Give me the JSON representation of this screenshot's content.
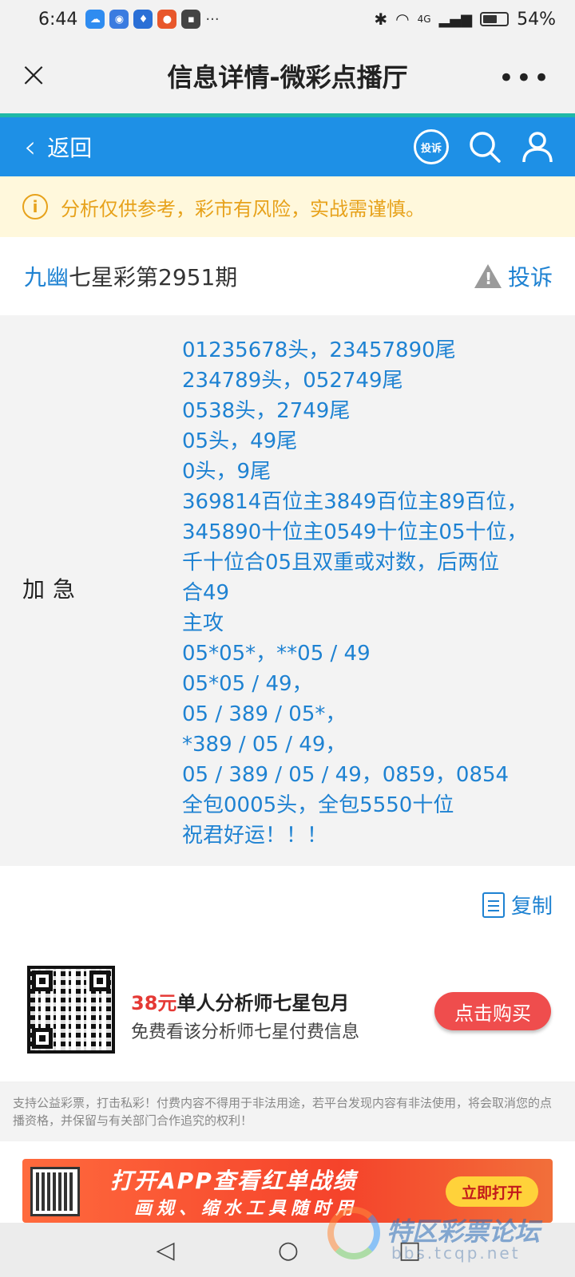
{
  "status_bar": {
    "time": "6:44",
    "more": "···",
    "network": "4G",
    "battery": "54%"
  },
  "title_bar": {
    "close_icon": "×",
    "title": "信息详情-微彩点播厅",
    "more_icon": "•••"
  },
  "nav": {
    "back_label": "返回",
    "complain_badge": "投诉"
  },
  "notice": {
    "icon": "i",
    "text": "分析仅供参考，彩市有风险，实战需谨慎。"
  },
  "post": {
    "author": "九幽",
    "issue": "七星彩第2951期",
    "report_label": "投诉",
    "label": "加急",
    "lines": [
      "01235678头，23457890尾",
      "234789头，052749尾",
      "0538头，2749尾",
      "05头，49尾",
      "0头，9尾",
      "369814百位主3849百位主89百位，",
      "345890十位主0549十位主05十位，",
      "千十位合05且双重或对数，后两位",
      "合49",
      "主攻",
      "05*05*，**05 / 49",
      "05*05 / 49，",
      "05 / 389 / 05*，",
      "*389 / 05 / 49，",
      "05 / 389 / 05 / 49，0859，0854",
      "全包0005头，全包5550十位",
      "祝君好运！！！"
    ]
  },
  "copy": {
    "label": "复制"
  },
  "promo": {
    "price": "38元",
    "title_rest": "单人分析师七星包月",
    "subtitle": "免费看该分析师七星付费信息",
    "buy_label": "点击购买"
  },
  "disclaimer": "支持公益彩票，打击私彩！付费内容不得用于非法用途，若平台发现内容有非法使用，将会取消您的点播资格，并保留与有关部门合作追究的权利！",
  "banner": {
    "title": "打开APP查看红单战绩",
    "subtitle": "画规、缩水工具随时用",
    "open_label": "立即打开"
  },
  "watermark": {
    "text": "特区彩票论坛",
    "url": "bbs.tcqp.net"
  },
  "colors": {
    "brand_blue": "#1e90e6",
    "link_blue": "#1e82d2",
    "notice_orange": "#e7a21b",
    "buy_red": "#ef4d4d"
  }
}
